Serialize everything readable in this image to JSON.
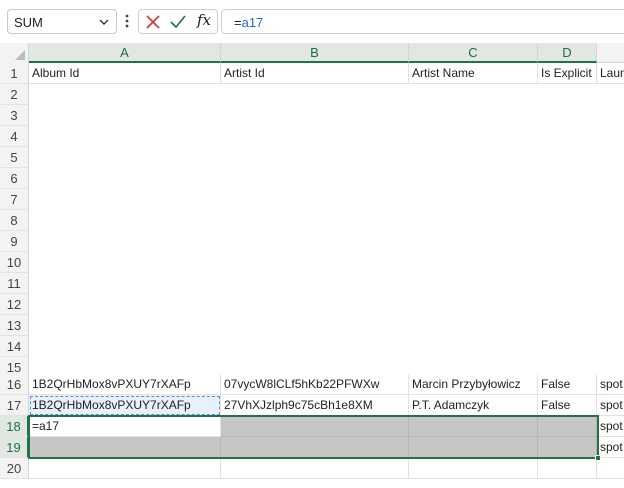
{
  "name_box": {
    "value": "SUM"
  },
  "formula_bar": {
    "equals": "=",
    "ref": "a17"
  },
  "columns": [
    {
      "letter": "A"
    },
    {
      "letter": "B"
    },
    {
      "letter": "C"
    },
    {
      "letter": "D"
    }
  ],
  "rows": [
    "1",
    "2",
    "3",
    "4",
    "5",
    "6",
    "7",
    "8",
    "9",
    "10",
    "11",
    "12",
    "13",
    "14",
    "15",
    "16",
    "17",
    "18",
    "19",
    "20"
  ],
  "header_row": {
    "a": "Album Id",
    "b": "Artist Id",
    "c": "Artist Name",
    "d": "Is Explicit",
    "e": "Laun"
  },
  "row16": {
    "a": "1B2QrHbMox8vPXUY7rXAFp",
    "b": "07vycW8lCLf5hKb22PFWXw",
    "c": "Marcin Przybyłowicz",
    "d": "False",
    "e": "spot"
  },
  "row17": {
    "a": "1B2QrHbMox8vPXUY7rXAFp",
    "b": "27VhXJzlph9c75cBh1e8XM",
    "c": "P.T. Adamczyk",
    "d": "False",
    "e": "spot"
  },
  "row18": {
    "a": "=a17",
    "e": "spot"
  },
  "row19": {
    "e": "spot"
  },
  "colors": {
    "accent": "#217346",
    "ref_blue": "#1f6bd6",
    "selection_gray": "#c6c6c6"
  }
}
